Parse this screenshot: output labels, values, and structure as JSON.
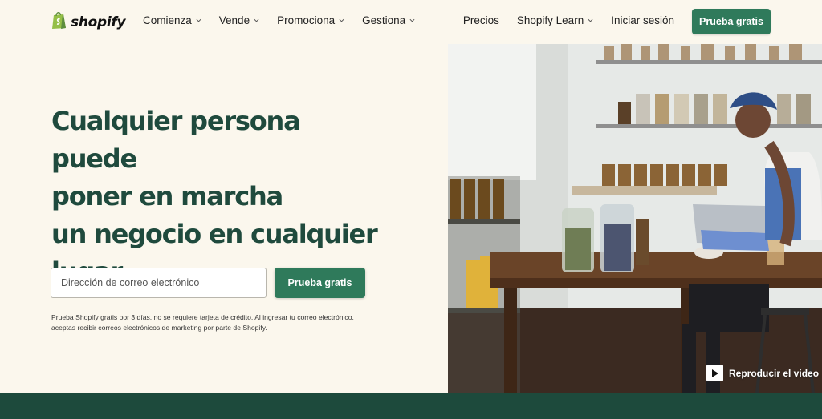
{
  "brand": {
    "name": "shopify",
    "accent": "#2f7a5b",
    "heading_color": "#1f4a3d",
    "footer_color": "#1d4a3c"
  },
  "nav": {
    "left": [
      {
        "label": "Comienza",
        "has_dropdown": true
      },
      {
        "label": "Vende",
        "has_dropdown": true
      },
      {
        "label": "Promociona",
        "has_dropdown": true
      },
      {
        "label": "Gestiona",
        "has_dropdown": true
      }
    ],
    "right": [
      {
        "label": "Precios",
        "has_dropdown": false
      },
      {
        "label": "Shopify Learn",
        "has_dropdown": true
      },
      {
        "label": "Iniciar sesión",
        "has_dropdown": false
      }
    ],
    "cta_label": "Prueba gratis"
  },
  "hero": {
    "headline_lines": [
      "Cualquier persona puede",
      "poner en marcha",
      "un negocio en cualquier",
      "lugar"
    ],
    "email_placeholder": "Dirección de correo electrónico",
    "cta_label": "Prueba gratis",
    "disclaimer_lines": [
      "Prueba Shopify gratis por 3 días, no se requiere tarjeta de crédito. Al ingresar tu correo electrónico,",
      "aceptas recibir correos electrónicos de marketing por parte de Shopify."
    ],
    "video_label": "Reproducir el video"
  },
  "icons": {
    "logo": "shopping-bag-icon",
    "dropdown": "chevron-down-icon",
    "play": "play-icon"
  }
}
